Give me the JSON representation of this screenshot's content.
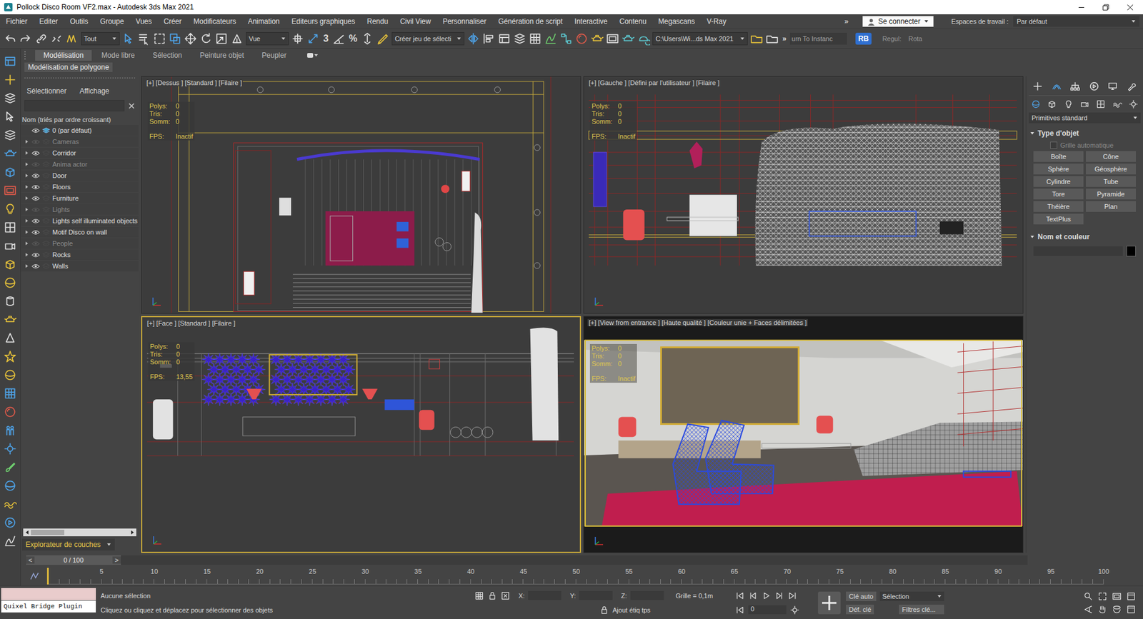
{
  "window": {
    "title": "Pollock Disco Room VF2.max - Autodesk 3ds Max 2021"
  },
  "menu": [
    "Fichier",
    "Editer",
    "Outils",
    "Groupe",
    "Vues",
    "Créer",
    "Modificateurs",
    "Animation",
    "Editeurs graphiques",
    "Rendu",
    "Civil View",
    "Personnaliser",
    "Génération de script",
    "Interactive",
    "Contenu",
    "Megascans",
    "V-Ray"
  ],
  "menu_overflow": "»",
  "account": "Se connecter",
  "workspace": {
    "label": "Espaces de travail :",
    "value": "Par défaut"
  },
  "toolbar": {
    "selection_filter": "Tout",
    "reference_coord": "Vue",
    "snap": "3",
    "percent_snap": "%",
    "selection_set": "Créer jeu de sélecti",
    "project_path": "C:\\Users\\Wi...ds Max 2021",
    "overflow": "»",
    "script_field": "urn To Instanc",
    "badge": "RB",
    "right_labels": [
      "Regul:",
      "Rota"
    ]
  },
  "ribbon": {
    "tabs": [
      {
        "label": "Modélisation",
        "selected": true
      },
      {
        "label": "Mode libre",
        "selected": false
      },
      {
        "label": "Sélection",
        "selected": false
      },
      {
        "label": "Peinture objet",
        "selected": false
      },
      {
        "label": "Peupler",
        "selected": false
      }
    ],
    "panel": "Modélisation de polygone"
  },
  "explorer": {
    "tabs": [
      "Sélectionner",
      "Affichage"
    ],
    "column": "Nom (triés par ordre croissant)",
    "layers": [
      {
        "name": "0 (par défaut)",
        "visible": true,
        "current": true,
        "expandable": false
      },
      {
        "name": "Cameras",
        "visible": false,
        "current": false,
        "expandable": true
      },
      {
        "name": "Corridor",
        "visible": true,
        "current": false,
        "expandable": true
      },
      {
        "name": "Anima actor",
        "visible": false,
        "current": false,
        "expandable": true
      },
      {
        "name": "Door",
        "visible": true,
        "current": false,
        "expandable": true
      },
      {
        "name": "Floors",
        "visible": true,
        "current": false,
        "expandable": true
      },
      {
        "name": "Furniture",
        "visible": true,
        "current": false,
        "expandable": true
      },
      {
        "name": "Lights",
        "visible": false,
        "current": false,
        "expandable": true
      },
      {
        "name": "Lights self illuminated objects",
        "visible": true,
        "current": false,
        "expandable": true
      },
      {
        "name": "Motif Disco on wall",
        "visible": true,
        "current": false,
        "expandable": true
      },
      {
        "name": "People",
        "visible": false,
        "current": false,
        "expandable": true
      },
      {
        "name": "Rocks",
        "visible": true,
        "current": false,
        "expandable": true
      },
      {
        "name": "Walls",
        "visible": true,
        "current": false,
        "expandable": true
      }
    ],
    "footer": "Explorateur de couches"
  },
  "viewports": [
    {
      "label": "[+] [Dessus ] [Standard ] [Filaire ]",
      "kind": "top",
      "active": false,
      "stats": [
        {
          "name": "Polys:",
          "value": "0"
        },
        {
          "name": "Tris:",
          "value": "0"
        },
        {
          "name": "Somm:",
          "value": "0"
        }
      ],
      "fps": {
        "name": "FPS:",
        "value": "Inactif"
      }
    },
    {
      "label": "[+] [Gauche ] [Défini par l'utilisateur ] [Filaire ]",
      "kind": "left",
      "active": false,
      "stats": [
        {
          "name": "Polys:",
          "value": "0"
        },
        {
          "name": "Tris:",
          "value": "0"
        },
        {
          "name": "Somm:",
          "value": "0"
        }
      ],
      "fps": {
        "name": "FPS:",
        "value": "Inactif"
      }
    },
    {
      "label": "[+] [Face ] [Standard ] [Filaire ]",
      "kind": "front",
      "active": true,
      "stats": [
        {
          "name": "Polys:",
          "value": "0"
        },
        {
          "name": "Tris:",
          "value": "0"
        },
        {
          "name": "Somm:",
          "value": "0"
        }
      ],
      "fps": {
        "name": "FPS:",
        "value": "13,55"
      }
    },
    {
      "label": "[+] [View from entrance ] [Haute qualité ] [Couleur unie + Faces délimitées ]",
      "kind": "camera",
      "active": false,
      "stats": [
        {
          "name": "Polys:",
          "value": "0"
        },
        {
          "name": "Tris:",
          "value": "0"
        },
        {
          "name": "Somm:",
          "value": "0"
        }
      ],
      "fps": {
        "name": "FPS:",
        "value": "Inactif"
      }
    }
  ],
  "command_panel": {
    "category": "Primitives standard",
    "object_type": {
      "title": "Type d'objet",
      "autogrid": {
        "label": "Grille automatique",
        "checked": false,
        "disabled": true
      },
      "buttons": [
        "Boîte",
        "Cône",
        "Sphère",
        "Géosphère",
        "Cylindre",
        "Tube",
        "Tore",
        "Pyramide",
        "Théière",
        "Plan",
        "TextPlus"
      ]
    },
    "name_color": {
      "title": "Nom et couleur",
      "color": "#000000"
    }
  },
  "time_slider": {
    "prev": "<",
    "value": "0 / 100",
    "next": ">"
  },
  "timeline": {
    "ticks": [
      "5",
      "10",
      "15",
      "20",
      "25",
      "30",
      "35",
      "40",
      "45",
      "50",
      "55",
      "60",
      "65",
      "70",
      "75",
      "80",
      "85",
      "90",
      "95",
      "100"
    ]
  },
  "status": {
    "plugin": "Quixel Bridge Plugin",
    "selection": "Aucune sélection",
    "prompt": "Cliquez ou cliquez et déplacez pour sélectionner des objets",
    "coords": [
      "X:",
      "Y:",
      "Z:"
    ],
    "grid": "Grille = 0,1m",
    "add_tag": "Ajout étiq tps",
    "frame": "0",
    "auto_key": "Clé auto",
    "key_mode": "Sélection",
    "set_key": "Déf. clé",
    "key_filters": "Filtres clé..."
  }
}
